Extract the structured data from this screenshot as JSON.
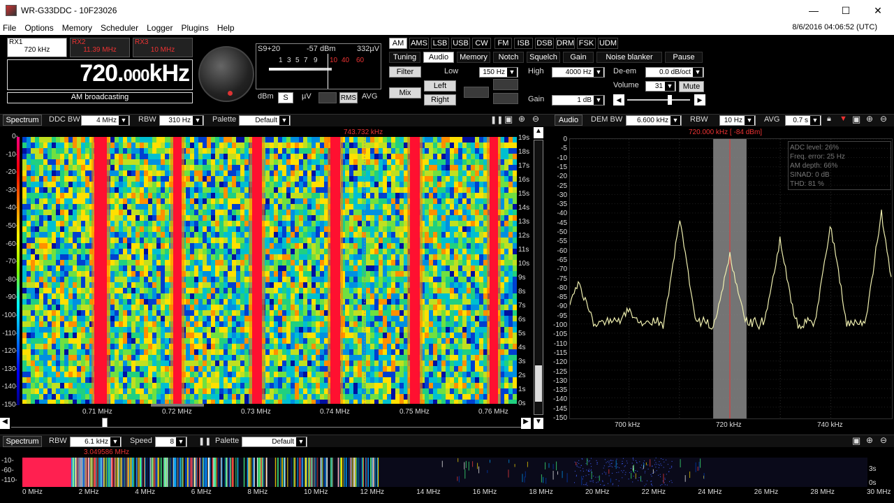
{
  "window": {
    "title": "WR-G33DDC - 10F23026",
    "minimize": "—",
    "maximize": "☐",
    "close": "✕"
  },
  "menu": [
    "File",
    "Options",
    "Memory",
    "Scheduler",
    "Logger",
    "Plugins",
    "Help"
  ],
  "datetime": "8/6/2016 04:06:52 (UTC)",
  "receivers": [
    {
      "name": "RX1",
      "freq": "720 kHz"
    },
    {
      "name": "RX2",
      "freq": "11.39 MHz"
    },
    {
      "name": "RX3",
      "freq": "10 MHz"
    }
  ],
  "frequency": {
    "main": "720.",
    "sub": "000",
    "unit": "kHz"
  },
  "mode_label": "AM broadcasting",
  "meter": {
    "reading": "S9+20",
    "dbm": "-57 dBm",
    "uv": "332µV",
    "scale": [
      "1",
      "3",
      "5",
      "7",
      "9",
      "10",
      "40",
      "60"
    ],
    "units": [
      "dBm",
      "S",
      "µV"
    ],
    "detectors": [
      "RMS",
      "AVG"
    ]
  },
  "modes": [
    "AM",
    "AMS",
    "LSB",
    "USB",
    "CW",
    "FM",
    "ISB",
    "DSB",
    "DRM",
    "FSK",
    "UDM"
  ],
  "active_mode": "AM",
  "tabs": [
    "Tuning",
    "Audio",
    "Memory",
    "Notch",
    "Squelch",
    "Gain",
    "Noise blanker",
    "Pause"
  ],
  "active_tab": "Audio",
  "audio": {
    "filter": "Filter",
    "mix": "Mix",
    "left": "Left",
    "right": "Right",
    "low_label": "Low",
    "low": "150 Hz",
    "high_label": "High",
    "high": "4000 Hz",
    "deem_label": "De-em",
    "deem": "0.0 dB/oct",
    "volume_label": "Volume",
    "volume": "31",
    "mute": "Mute",
    "gain_label": "Gain",
    "gain": "1 dB"
  },
  "spectrum": {
    "title": "Spectrum",
    "ddcbw_label": "DDC BW",
    "ddcbw": "4 MHz",
    "rbw_label": "RBW",
    "rbw": "310 Hz",
    "palette_label": "Palette",
    "palette": "Default",
    "cursor": "743.732 kHz",
    "yticks": [
      "0-",
      "-10-",
      "-20-",
      "-30-",
      "-40-",
      "-50-",
      "-60-",
      "-70-",
      "-80-",
      "-90-",
      "-100-",
      "-110-",
      "-120-",
      "-130-",
      "-140-",
      "-150-"
    ],
    "xticks": [
      "0.71 MHz",
      "0.72 MHz",
      "0.73 MHz",
      "0.74 MHz",
      "0.75 MHz",
      "0.76 MHz"
    ],
    "tticks": [
      "19s",
      "18s",
      "17s",
      "16s",
      "15s",
      "14s",
      "13s",
      "12s",
      "11s",
      "10s",
      "9s",
      "8s",
      "7s",
      "6s",
      "5s",
      "4s",
      "3s",
      "2s",
      "1s",
      "0s"
    ]
  },
  "audio_panel": {
    "title": "Audio",
    "dembw_label": "DEM BW",
    "dembw": "6.600 kHz",
    "rbw_label": "RBW",
    "rbw": "10 Hz",
    "avg_label": "AVG",
    "avg": "0.7 s",
    "cursor": "720.000 kHz [  -84 dBm]",
    "yticks": [
      "0",
      "-5",
      "-10",
      "-15",
      "-20",
      "-25",
      "-30",
      "-35",
      "-40",
      "-45",
      "-50",
      "-55",
      "-60",
      "-65",
      "-70",
      "-75",
      "-80",
      "-85",
      "-90",
      "-95",
      "-100",
      "-105",
      "-110",
      "-115",
      "-120",
      "-125",
      "-130",
      "-135",
      "-140",
      "-145",
      "-150"
    ],
    "xticks": [
      "700 kHz",
      "720 kHz",
      "740 kHz"
    ],
    "stats": [
      "ADC level: 26%",
      "Freq. error: 25 Hz",
      "AM depth: 66%",
      "SINAD: 0 dB",
      "THD: 81 %"
    ]
  },
  "bottom": {
    "title": "Spectrum",
    "rbw_label": "RBW",
    "rbw": "6.1 kHz",
    "speed_label": "Speed",
    "speed": "8",
    "palette_label": "Palette",
    "palette": "Default",
    "cursor": "3.049586 MHz",
    "yticks": [
      "-10-",
      "-60-",
      "-110-"
    ],
    "xticks": [
      "0 MHz",
      "2 MHz",
      "4 MHz",
      "6 MHz",
      "8 MHz",
      "10 MHz",
      "12 MHz",
      "14 MHz",
      "16 MHz",
      "18 MHz",
      "20 MHz",
      "22 MHz",
      "24 MHz",
      "26 MHz",
      "28 MHz",
      "30 MHz"
    ],
    "tticks": [
      "3s",
      "0s"
    ]
  }
}
